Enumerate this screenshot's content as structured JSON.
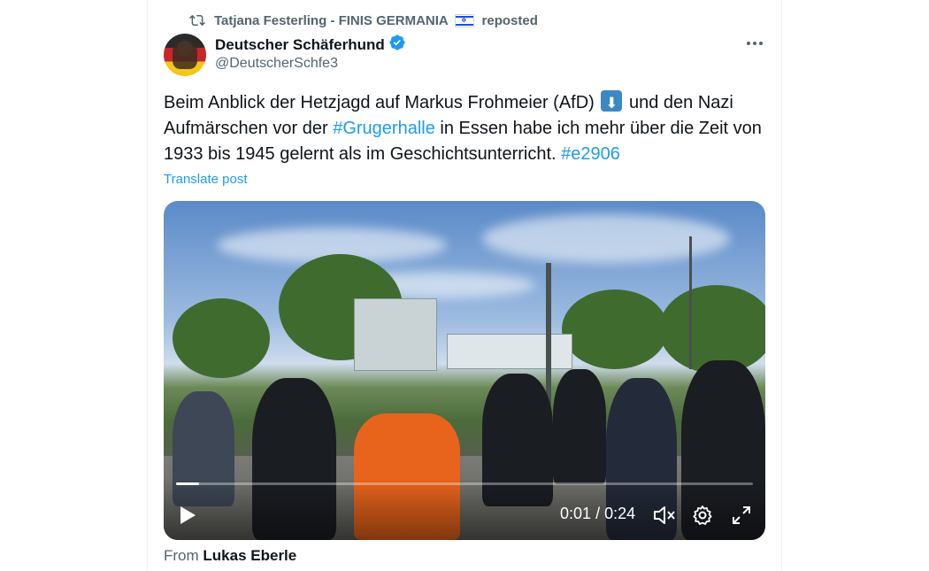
{
  "repost": {
    "reposter": "Tatjana Festerling - FINIS GERMANIA",
    "label": "reposted"
  },
  "author": {
    "display_name": "Deutscher Schäferhund",
    "handle": "@DeutscherSchfe3",
    "verified": true
  },
  "post": {
    "text_1": "Beim Anblick der Hetzjagd auf Markus Frohmeier (AfD)",
    "emoji": "arrow-down-emoji",
    "text_2": " und den Nazi Aufmärschen vor der ",
    "hashtag_1": "#Grugerhalle",
    "text_3": " in Essen habe ich mehr über die Zeit von 1933 bis 1945 gelernt als im Geschichtsunterricht. ",
    "hashtag_2": "#e2906",
    "translate_label": "Translate post"
  },
  "video": {
    "current_time": "0:01",
    "separator": "/",
    "duration": "0:24",
    "progress_fraction": 0.04,
    "muted": true,
    "icons": [
      "play-icon",
      "muted-speaker-icon",
      "settings-gear-icon",
      "fullscreen-icon"
    ]
  },
  "attribution": {
    "prefix": "From",
    "source": "Lukas Eberle"
  },
  "colors": {
    "link": "#1d9bf0",
    "secondary_text": "#536471",
    "primary_text": "#0f1419",
    "verified_badge": "#1d9bf0"
  }
}
